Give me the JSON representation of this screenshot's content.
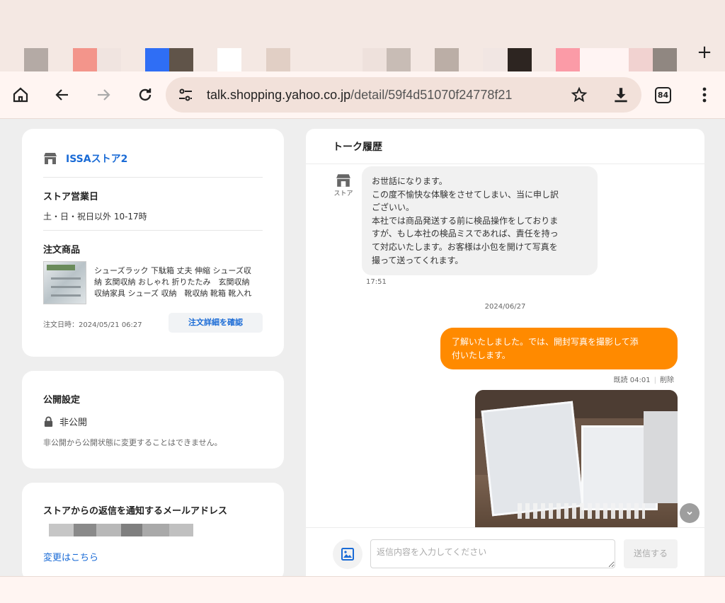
{
  "browser": {
    "url_host": "talk.shopping.yahoo.co.jp",
    "url_path": "/detail/59f4d51070f24778f21",
    "tab_count": "84",
    "tab_swatches": [
      {
        "color": "#b4aaa5"
      },
      {
        "color": "#f3958b"
      },
      {
        "color": "#f0e4e0"
      },
      {
        "color": "#2f6ef5"
      },
      {
        "color": "#605449"
      },
      {
        "color": "#ffffff"
      },
      {
        "color": "#e1cfc5"
      },
      {
        "color": "#eee1dc"
      },
      {
        "color": "#c8bcb5"
      },
      {
        "color": "#bbaea6"
      },
      {
        "color": "#f1e6e3"
      },
      {
        "color": "#2d2521"
      },
      {
        "color": "#fb9ba7"
      },
      {
        "color": "#fff4f3"
      },
      {
        "color": "#f1d2d0"
      },
      {
        "color": "#908781"
      }
    ]
  },
  "store_card": {
    "store_name": "ISSAストア2",
    "hours_title": "ストア営業日",
    "hours_text": "土・日・祝日以外 10-17時",
    "product_title": "注文商品",
    "product_name": "シューズラック 下駄箱 丈夫 伸縮 シューズ収納 玄関収納 おしゃれ 折りたたみ　玄関収納 収納家具 シューズ 収納　靴収納 靴箱 靴入れ",
    "order_date": "注文日時：2024/05/21 06:27",
    "order_button": "注文詳細を確認"
  },
  "privacy_card": {
    "title": "公開設定",
    "status": "非公開",
    "note": "非公開から公開状態に変更することはできません。"
  },
  "email_card": {
    "title": "ストアからの返信を通知するメールアドレス",
    "change_link": "変更はこちら"
  },
  "chat": {
    "title": "トーク履歴",
    "store_label": "ストア",
    "messages": [
      {
        "text_lines": [
          "お世話になります。",
          "この度不愉快な体験をさせてしまい、当に申し訳",
          "ございい。",
          "本社では商品発送する前に検品操作をしておりま",
          "すが、もし本社の検品ミスであれば、責任を持っ",
          "て対応いたします。お客様は小包を開けて写真を",
          "撮って送ってくれます。"
        ],
        "time": "17:51"
      }
    ],
    "date_separator": "2024/06/27",
    "reply": {
      "text_lines": [
        "了解いたしました。では、開封写真を撮影して添",
        "付いたします。"
      ],
      "read": "既読 04:01",
      "delete": "削除"
    },
    "input_placeholder": "返信内容を入力してください",
    "send_label": "送信する"
  }
}
